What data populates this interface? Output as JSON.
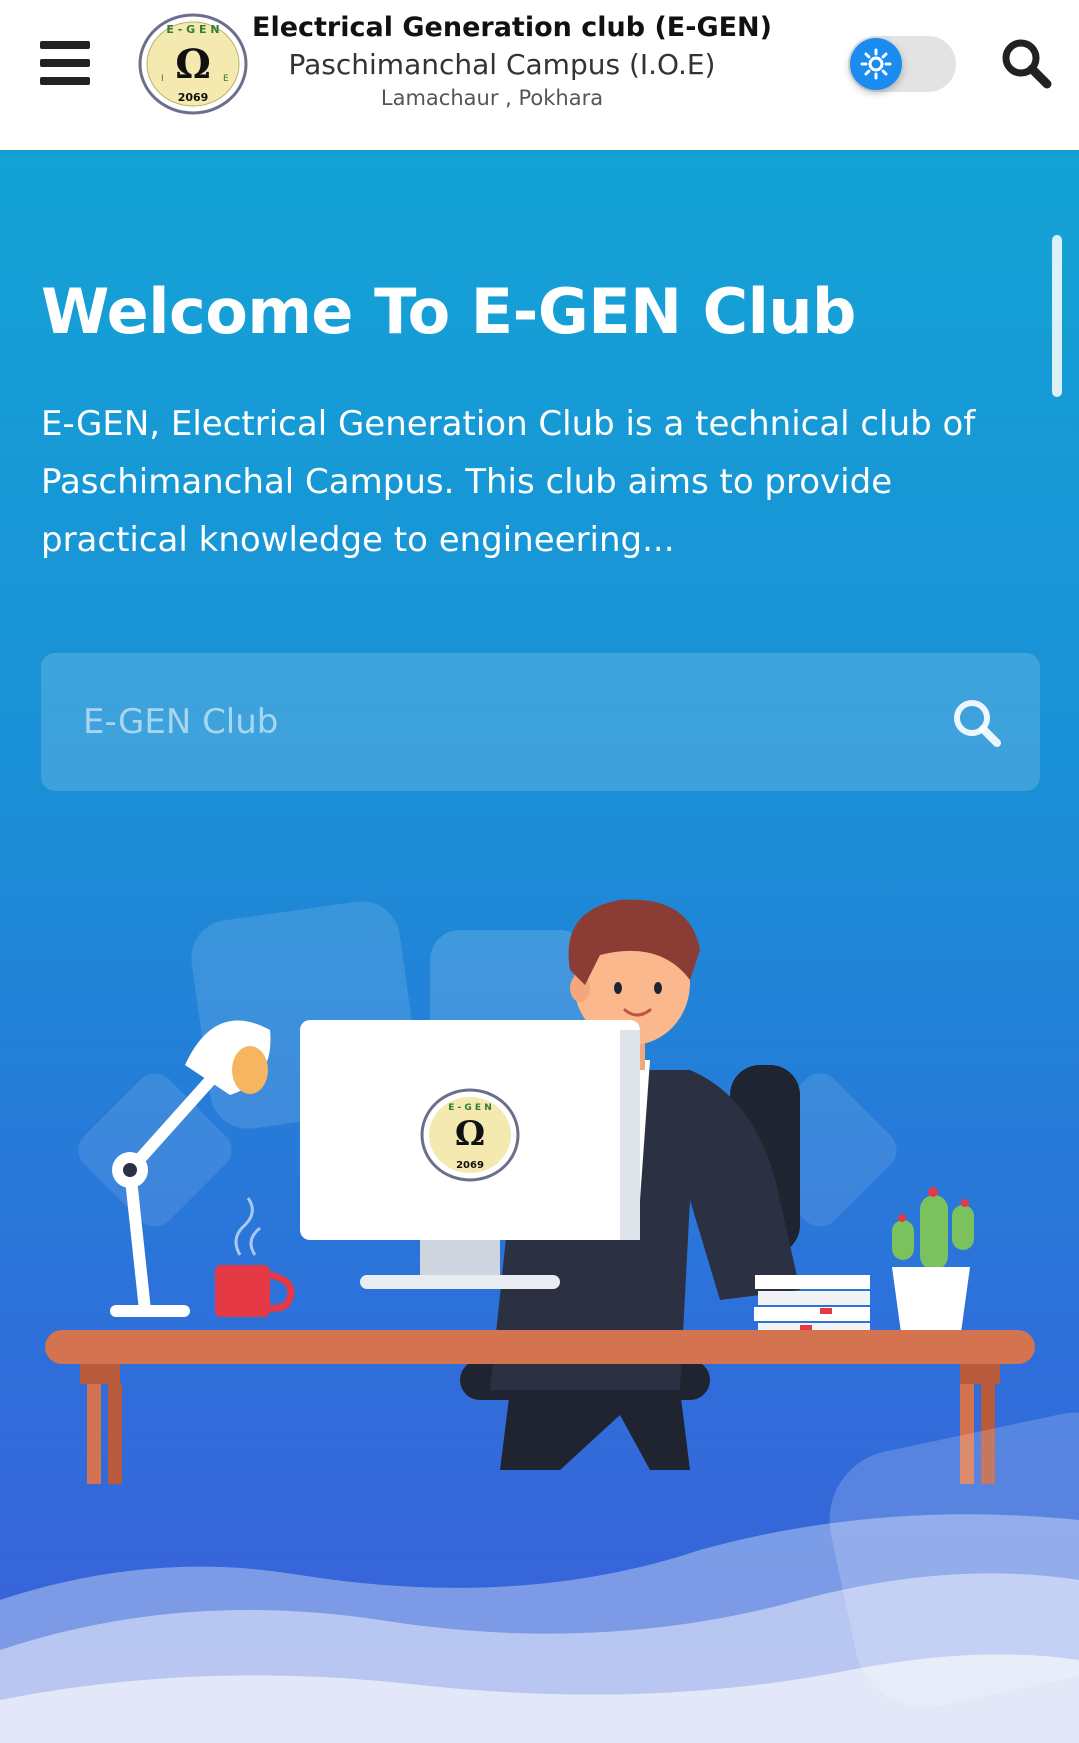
{
  "header": {
    "menu_icon": "hamburger-menu-icon",
    "logo": {
      "ring_text": "E - G E N",
      "side_text": "Paschimanchal Campus",
      "year": "2069",
      "letters": [
        "I",
        "O",
        "E"
      ]
    },
    "title": "Electrical Generation club (E-GEN)",
    "subtitle": "Paschimanchal Campus (I.O.E)",
    "location": "Lamachaur , Pokhara",
    "theme_toggle_icon": "sun-icon",
    "search_icon": "search-icon"
  },
  "hero": {
    "title": "Welcome To E-GEN Club",
    "description": "E-GEN, Electrical Generation Club is a technical club of Paschimanchal Campus. This club aims to provide practical knowledge to engineering...",
    "search_placeholder": "E-GEN Club",
    "search_icon": "search-icon"
  },
  "colors": {
    "hero_top": "#14a3d6",
    "hero_bottom": "#3c5fd8",
    "toggle_knob": "#1a8cf0",
    "accent_red": "#e53945"
  }
}
